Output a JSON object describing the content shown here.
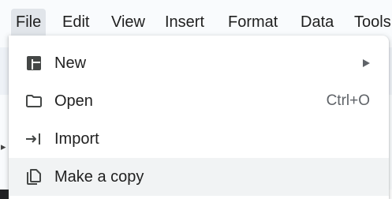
{
  "menubar": {
    "items": [
      {
        "label": "File"
      },
      {
        "label": "Edit"
      },
      {
        "label": "View"
      },
      {
        "label": "Insert"
      },
      {
        "label": "Format"
      },
      {
        "label": "Data"
      },
      {
        "label": "Tools"
      }
    ]
  },
  "file_menu": {
    "items": [
      {
        "label": "New",
        "icon": "new-spreadsheet-icon",
        "has_submenu": true
      },
      {
        "label": "Open",
        "icon": "folder-icon",
        "shortcut": "Ctrl+O"
      },
      {
        "label": "Import",
        "icon": "import-arrow-icon"
      },
      {
        "label": "Make a copy",
        "icon": "copy-icon"
      }
    ]
  },
  "colors": {
    "menubar_active_bg": "#e1e5ea",
    "menu_bg": "#ffffff",
    "hover_bg": "#f1f3f4",
    "icon_color": "#444746",
    "shortcut_color": "#5f6368"
  }
}
